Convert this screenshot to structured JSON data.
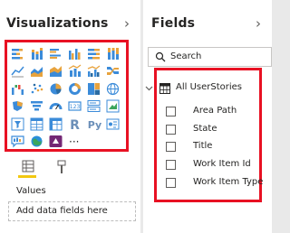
{
  "visualizations": {
    "title": "Visualizations",
    "collapse_icon": "chevron-right-icon",
    "gallery": [
      "stacked-bar-chart",
      "stacked-column-chart",
      "clustered-bar-chart",
      "clustered-column-chart",
      "100-percent-stacked-bar-chart",
      "100-percent-stacked-column-chart",
      "line-chart",
      "area-chart",
      "stacked-area-chart",
      "line-and-stacked-column-chart",
      "line-and-clustered-column-chart",
      "ribbon-chart",
      "waterfall-chart",
      "scatter-chart",
      "pie-chart",
      "donut-chart",
      "treemap",
      "map",
      "filled-map",
      "funnel",
      "gauge",
      "card",
      "multi-row-card",
      "kpi",
      "slicer",
      "table",
      "matrix",
      "r-script-visual",
      "python-visual",
      "key-influencers",
      "qa-visual",
      "arcgis-map",
      "powerapps-visual",
      "more-visuals"
    ],
    "r_glyph": "R",
    "python_glyph": "Py",
    "more_glyph": "···",
    "tabs": [
      "fields-tab-icon",
      "format-tab-icon"
    ],
    "values_label": "Values",
    "add_fields_placeholder": "Add data fields here"
  },
  "fields": {
    "title": "Fields",
    "collapse_icon": "chevron-right-icon",
    "search_placeholder": "Search",
    "table": {
      "name": "All UserStories",
      "expanded": true,
      "items": [
        "Area Path",
        "State",
        "Title",
        "Work Item Id",
        "Work Item Type"
      ]
    }
  },
  "colors": {
    "highlight_red": "#e81123",
    "accent_yellow": "#f2c811",
    "chart_blue": "#3b8bd9",
    "chart_orange": "#e8a33d",
    "chart_dark": "#2b6ca3"
  }
}
